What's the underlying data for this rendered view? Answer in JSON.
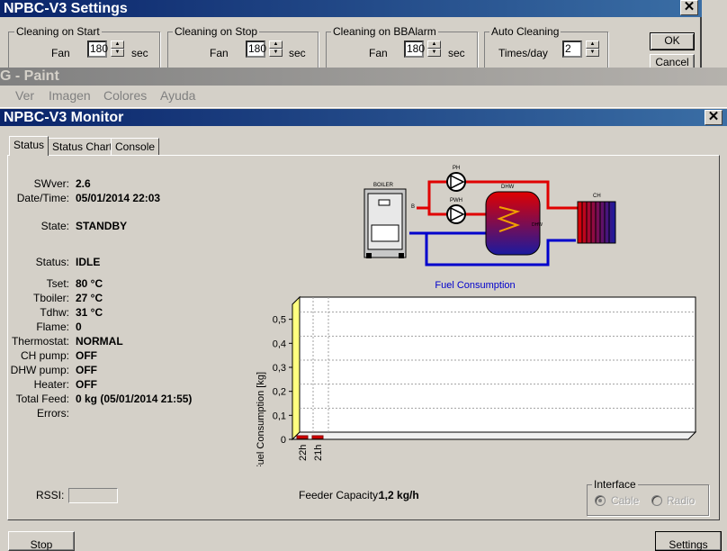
{
  "settings": {
    "title": "NPBC-V3 Settings",
    "ok_label": "OK",
    "cancel_label": "Cancel",
    "groups": [
      {
        "title": "Cleaning on Start",
        "label": "Fan",
        "value": "180",
        "unit": "sec"
      },
      {
        "title": "Cleaning on Stop",
        "label": "Fan",
        "value": "180",
        "unit": "sec"
      },
      {
        "title": "Cleaning  on BBAlarm",
        "label": "Fan",
        "value": "180",
        "unit": "sec"
      },
      {
        "title": "Auto Cleaning",
        "label": "Times/day",
        "value": "2",
        "unit": ""
      }
    ]
  },
  "paint": {
    "title": "G - Paint",
    "menu": [
      "Ver",
      "Imagen",
      "Colores",
      "Ayuda"
    ]
  },
  "monitor": {
    "title": "NPBC-V3 Monitor",
    "tabs": [
      "Status",
      "Status Chart",
      "Console"
    ],
    "status_fields": [
      {
        "label": "SWver:",
        "value": "2.6"
      },
      {
        "label": "Date/Time:",
        "value": "05/01/2014 22:03"
      },
      {
        "label": "State:",
        "value": "STANDBY"
      },
      {
        "label": "Status:",
        "value": "IDLE"
      },
      {
        "label": "Tset:",
        "value": "80 °C"
      },
      {
        "label": "Tboiler:",
        "value": "27 °C"
      },
      {
        "label": "Tdhw:",
        "value": "31 °C"
      },
      {
        "label": "Flame:",
        "value": "0"
      },
      {
        "label": "Thermostat:",
        "value": "NORMAL"
      },
      {
        "label": "CH pump:",
        "value": "OFF"
      },
      {
        "label": "DHW pump:",
        "value": "OFF"
      },
      {
        "label": "Heater:",
        "value": "OFF"
      },
      {
        "label": "Total Feed:",
        "value": "0 kg (05/01/2014 21:55)"
      },
      {
        "label": "Errors:",
        "value": ""
      }
    ],
    "diagram": {
      "boiler_label": "BOILER",
      "ph_label": "PH",
      "pwh_label": "PWH",
      "dhw_label": "DHW",
      "ch_label": "CH",
      "b_label": "B",
      "dhw_side_label": "DHW"
    },
    "rssi_label": "RSSI:",
    "feeder_label": "Feeder Capacity:",
    "feeder_value": "1,2 kg/h",
    "interface": {
      "title": "Interface",
      "options": [
        "Cable",
        "Radio"
      ],
      "selected": "Cable"
    },
    "bottom_left_button": "Stop",
    "bottom_right_button": "Settings"
  },
  "chart_data": {
    "type": "bar",
    "title": "Fuel Consumption",
    "ylabel": "Fuel Consumption [kg]",
    "xlabel": "",
    "categories": [
      "22h",
      "21h"
    ],
    "values": [
      0,
      0
    ],
    "ylim": [
      0,
      0.6
    ],
    "yticks": [
      "0",
      "0,1",
      "0,2",
      "0,3",
      "0,4",
      "0,5"
    ],
    "grid": true
  }
}
